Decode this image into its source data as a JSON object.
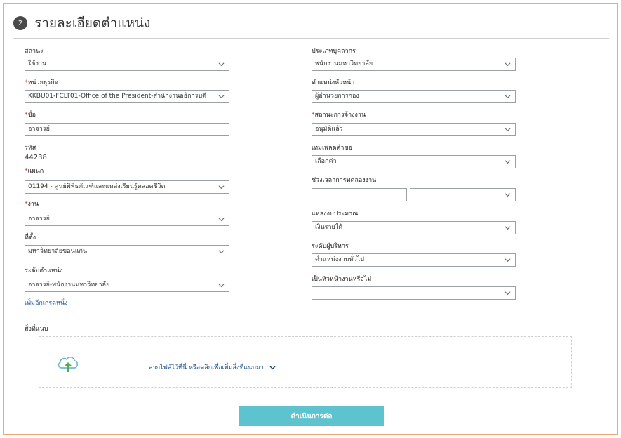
{
  "header": {
    "step": "2",
    "title": "รายละเอียดตำแหน่ง"
  },
  "left": {
    "status": {
      "label": "สถานะ",
      "value": "ใช้งาน"
    },
    "business_unit": {
      "label": "หน่วยธุรกิจ",
      "value": "KKBU01-FCLT01-Office of the President-สำนักงานอธิการบดี"
    },
    "name": {
      "label": "ชื่อ",
      "value": "อาจารย์"
    },
    "code": {
      "label": "รหัส",
      "value": "44238"
    },
    "department": {
      "label": "แผนก",
      "value": "01194 - ศูนย์พิพิธภัณฑ์และแหล่งเรียนรู้ตลอดชีวิต"
    },
    "job": {
      "label": "งาน",
      "value": "อาจารย์"
    },
    "location": {
      "label": "ที่ตั้ง",
      "value": "มหาวิทยาลัยขอนแก่น"
    },
    "position_level": {
      "label": "ระดับตำแหน่ง",
      "value": "อาจารย์-พนักงานมหาวิทยาลัย"
    },
    "add_grade_link": "เพิ่มอีกเกรดหนึ่ง"
  },
  "right": {
    "personnel_type": {
      "label": "ประเภทบุคลากร",
      "value": "พนักงานมหาวิทยาลัย"
    },
    "head_position": {
      "label": "ตำแหน่งหัวหน้า",
      "value": "ผู้อำนวยการกอง"
    },
    "employment_status": {
      "label": "สถานะการจ้างงาน",
      "value": "อนุมัติแล้ว"
    },
    "request_template": {
      "label": "เทมเพลตคำขอ",
      "value": "เลือกค่า"
    },
    "probation": {
      "label": "ช่วงเวลาการทดลองงาน",
      "value": "",
      "unit": ""
    },
    "budget_source": {
      "label": "แหล่งงบประมาณ",
      "value": "เงินรายได้"
    },
    "executive_level": {
      "label": "ระดับผู้บริหาร",
      "value": "ตำแหน่งงานทั่วไป"
    },
    "is_head": {
      "label": "เป็นหัวหน้างานหรือไม่",
      "value": ""
    }
  },
  "attachments": {
    "label": "สิ่งที่แนบ",
    "drop_text": "ลากไฟล์ไว้ที่นี่ หรือคลิกเพื่อเพิ่มสิ่งที่แนบมา"
  },
  "footer": {
    "continue_label": "ดำเนินการต่อ"
  },
  "icons": {
    "chevron": "chevron-down-icon",
    "upload": "cloud-upload-icon"
  },
  "colors": {
    "primary_button": "#5cc3cf",
    "link": "#1b5aa6",
    "frame_border": "#f0a878",
    "required": "#c0392b"
  }
}
